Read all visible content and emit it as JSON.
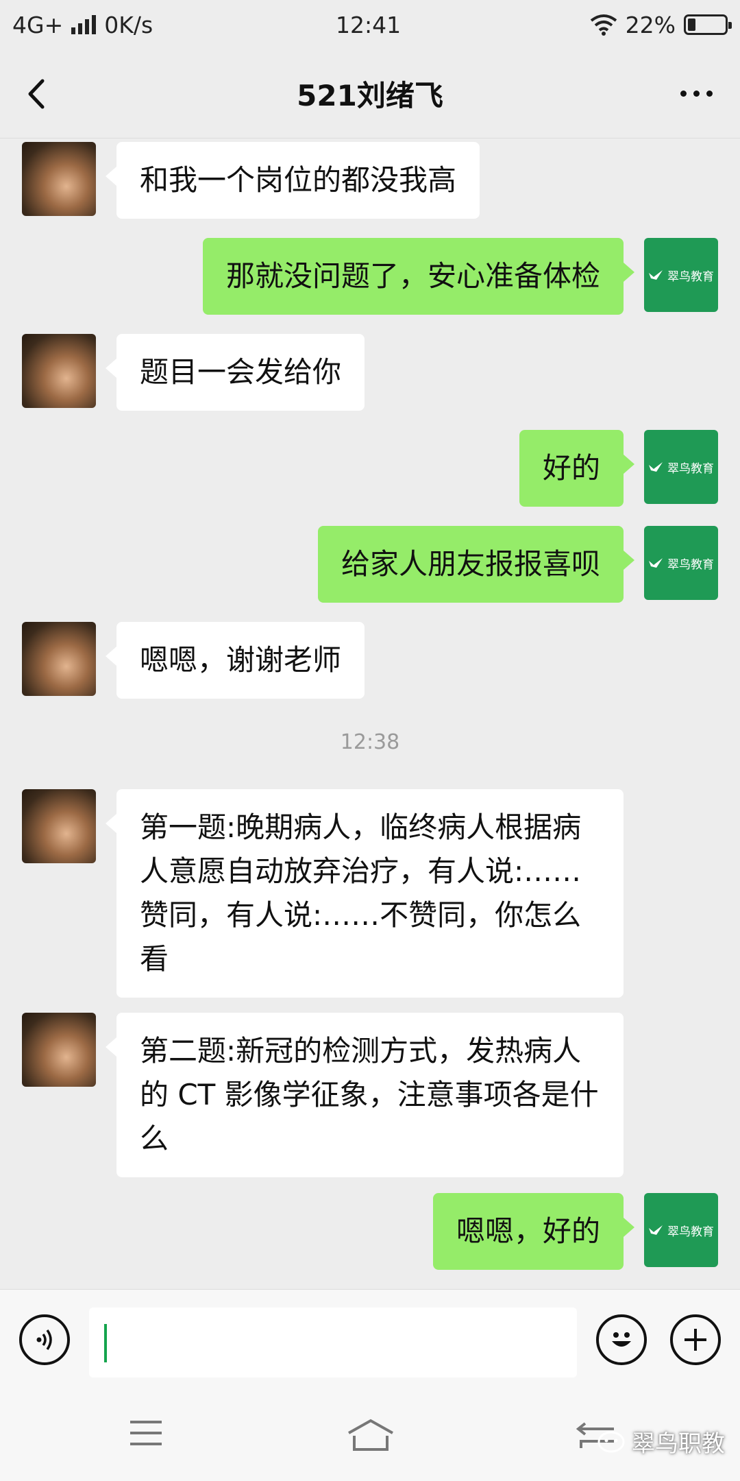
{
  "status_bar": {
    "network": "4G+",
    "speed": "0K/s",
    "time": "12:41",
    "battery": "22%"
  },
  "nav": {
    "title": "521刘绪飞"
  },
  "logo_text": "翠鸟教育",
  "messages": [
    {
      "side": "left",
      "text": "和我一个岗位的都没我高"
    },
    {
      "side": "right",
      "text": "那就没问题了，安心准备体检"
    },
    {
      "side": "left",
      "text": "题目一会发给你"
    },
    {
      "side": "right",
      "text": "好的"
    },
    {
      "side": "right",
      "text": "给家人朋友报报喜呗"
    },
    {
      "side": "left",
      "text": "嗯嗯，谢谢老师"
    },
    {
      "side": "left",
      "text": "第一题:晚期病人，临终病人根据病人意愿自动放弃治疗，有人说:……赞同，有人说:……不赞同，你怎么看"
    },
    {
      "side": "left",
      "text": "第二题:新冠的检测方式，发热病人的 CT 影像学征象，注意事项各是什么"
    },
    {
      "side": "right",
      "text": "嗯嗯，好的"
    }
  ],
  "timestamp": "12:38",
  "input": {
    "value": "",
    "placeholder": ""
  },
  "watermark": "翠鸟职教",
  "colors": {
    "self_bubble": "#95ec69",
    "other_bubble": "#ffffff",
    "background": "#ededed",
    "logo_green": "#1f9a55"
  }
}
